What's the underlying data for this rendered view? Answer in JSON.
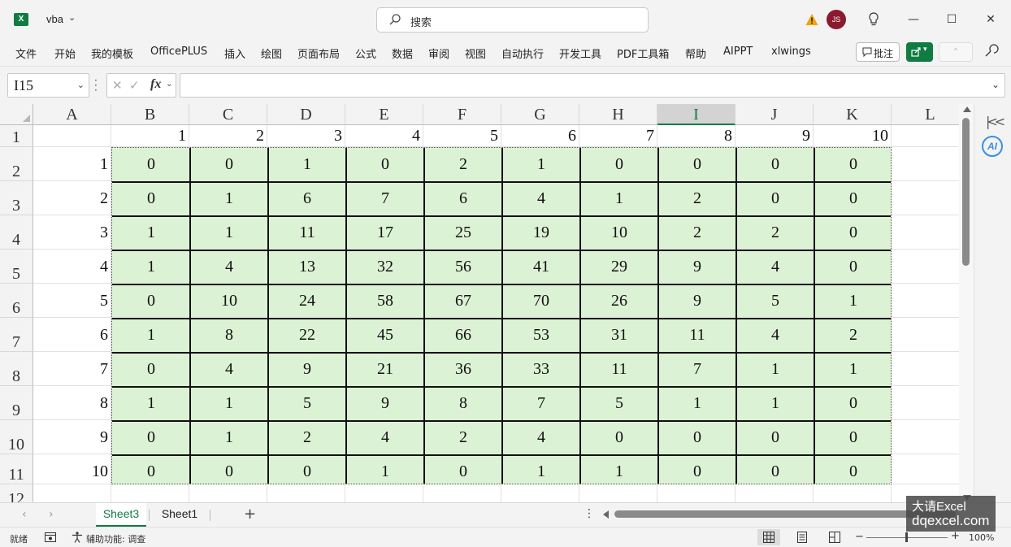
{
  "app": {
    "logo_letter": "X",
    "filename": "vba",
    "search_placeholder": "搜索",
    "user_initials": "JS"
  },
  "menu": [
    "文件",
    "开始",
    "我的模板",
    "OfficePLUS",
    "插入",
    "绘图",
    "页面布局",
    "公式",
    "数据",
    "审阅",
    "视图",
    "自动执行",
    "开发工具",
    "PDF工具箱",
    "帮助",
    "AIPPT",
    "xlwings"
  ],
  "ribbon_right": {
    "comment_label": "批注"
  },
  "formula_bar": {
    "name_box": "I15",
    "formula": ""
  },
  "columns": [
    "A",
    "B",
    "C",
    "D",
    "E",
    "F",
    "G",
    "H",
    "I",
    "J",
    "K",
    "L"
  ],
  "selected_column": "I",
  "rows": [
    "1",
    "2",
    "3",
    "4",
    "5",
    "6",
    "7",
    "8",
    "9",
    "10",
    "11",
    "12"
  ],
  "header_row": [
    "1",
    "2",
    "3",
    "4",
    "5",
    "6",
    "7",
    "8",
    "9",
    "10"
  ],
  "row_labels": [
    "1",
    "2",
    "3",
    "4",
    "5",
    "6",
    "7",
    "8",
    "9",
    "10"
  ],
  "table": [
    [
      "0",
      "0",
      "1",
      "0",
      "2",
      "1",
      "0",
      "0",
      "0",
      "0"
    ],
    [
      "0",
      "1",
      "6",
      "7",
      "6",
      "4",
      "1",
      "2",
      "0",
      "0"
    ],
    [
      "1",
      "1",
      "11",
      "17",
      "25",
      "19",
      "10",
      "2",
      "2",
      "0"
    ],
    [
      "1",
      "4",
      "13",
      "32",
      "56",
      "41",
      "29",
      "9",
      "4",
      "0"
    ],
    [
      "0",
      "10",
      "24",
      "58",
      "67",
      "70",
      "26",
      "9",
      "5",
      "1"
    ],
    [
      "1",
      "8",
      "22",
      "45",
      "66",
      "53",
      "31",
      "11",
      "4",
      "2"
    ],
    [
      "0",
      "4",
      "9",
      "21",
      "36",
      "33",
      "11",
      "7",
      "1",
      "1"
    ],
    [
      "1",
      "1",
      "5",
      "9",
      "8",
      "7",
      "5",
      "1",
      "1",
      "0"
    ],
    [
      "0",
      "1",
      "2",
      "4",
      "2",
      "4",
      "0",
      "0",
      "0",
      "0"
    ],
    [
      "0",
      "0",
      "0",
      "1",
      "0",
      "1",
      "1",
      "0",
      "0",
      "0"
    ]
  ],
  "table_fill_color": "#dcf2d4",
  "sheets": [
    {
      "name": "Sheet3",
      "active": true
    },
    {
      "name": "Sheet1",
      "active": false
    }
  ],
  "status": {
    "ready": "就绪",
    "accessibility": "辅助功能: 调查",
    "zoom": "100%"
  },
  "watermark": {
    "line1": "大请Excel",
    "line2": "dqexcel.com"
  },
  "accent_color": "#107c41"
}
